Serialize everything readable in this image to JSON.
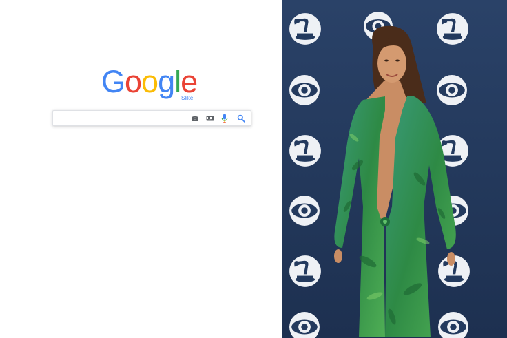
{
  "search_page": {
    "logo": {
      "letters": [
        {
          "char": "G",
          "color": "#4285F4"
        },
        {
          "char": "o",
          "color": "#EA4335"
        },
        {
          "char": "o",
          "color": "#FBBC05"
        },
        {
          "char": "g",
          "color": "#4285F4"
        },
        {
          "char": "l",
          "color": "#34A853"
        },
        {
          "char": "e",
          "color": "#EA4335"
        }
      ],
      "subtitle": "Slike",
      "subtitle_color": "#4285F4"
    },
    "search_input": {
      "value": "",
      "placeholder": ""
    },
    "icons": [
      "camera-icon",
      "keyboard-icon",
      "microphone-icon",
      "search-icon"
    ]
  },
  "photo": {
    "backdrop_logos": [
      "cbs-eye-logo",
      "grammy-gramophone-logo"
    ],
    "colors": {
      "backdrop": "#233a5e",
      "dress": "#2f8a4a",
      "skin": "#c98d64",
      "hair": "#4a2c1a"
    }
  }
}
